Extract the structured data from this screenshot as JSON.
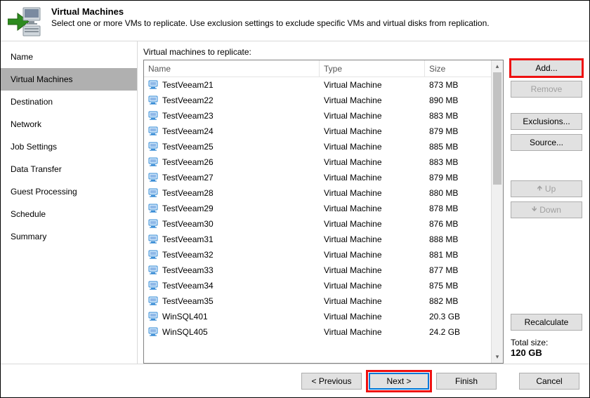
{
  "header": {
    "title": "Virtual Machines",
    "subtitle": "Select one or more VMs to replicate. Use exclusion settings to exclude specific VMs and virtual disks from replication."
  },
  "nav": {
    "items": [
      {
        "label": "Name",
        "selected": false
      },
      {
        "label": "Virtual Machines",
        "selected": true
      },
      {
        "label": "Destination",
        "selected": false
      },
      {
        "label": "Network",
        "selected": false
      },
      {
        "label": "Job Settings",
        "selected": false
      },
      {
        "label": "Data Transfer",
        "selected": false
      },
      {
        "label": "Guest Processing",
        "selected": false
      },
      {
        "label": "Schedule",
        "selected": false
      },
      {
        "label": "Summary",
        "selected": false
      }
    ]
  },
  "grid": {
    "label": "Virtual machines to replicate:",
    "columns": {
      "name": "Name",
      "type": "Type",
      "size": "Size"
    },
    "rows": [
      {
        "name": "TestVeeam21",
        "type": "Virtual Machine",
        "size": "873 MB"
      },
      {
        "name": "TestVeeam22",
        "type": "Virtual Machine",
        "size": "890 MB"
      },
      {
        "name": "TestVeeam23",
        "type": "Virtual Machine",
        "size": "883 MB"
      },
      {
        "name": "TestVeeam24",
        "type": "Virtual Machine",
        "size": "879 MB"
      },
      {
        "name": "TestVeeam25",
        "type": "Virtual Machine",
        "size": "885 MB"
      },
      {
        "name": "TestVeeam26",
        "type": "Virtual Machine",
        "size": "883 MB"
      },
      {
        "name": "TestVeeam27",
        "type": "Virtual Machine",
        "size": "879 MB"
      },
      {
        "name": "TestVeeam28",
        "type": "Virtual Machine",
        "size": "880 MB"
      },
      {
        "name": "TestVeeam29",
        "type": "Virtual Machine",
        "size": "878 MB"
      },
      {
        "name": "TestVeeam30",
        "type": "Virtual Machine",
        "size": "876 MB"
      },
      {
        "name": "TestVeeam31",
        "type": "Virtual Machine",
        "size": "888 MB"
      },
      {
        "name": "TestVeeam32",
        "type": "Virtual Machine",
        "size": "881 MB"
      },
      {
        "name": "TestVeeam33",
        "type": "Virtual Machine",
        "size": "877 MB"
      },
      {
        "name": "TestVeeam34",
        "type": "Virtual Machine",
        "size": "875 MB"
      },
      {
        "name": "TestVeeam35",
        "type": "Virtual Machine",
        "size": "882 MB"
      },
      {
        "name": "WinSQL401",
        "type": "Virtual Machine",
        "size": "20.3 GB"
      },
      {
        "name": "WinSQL405",
        "type": "Virtual Machine",
        "size": "24.2 GB"
      }
    ]
  },
  "right": {
    "add": "Add...",
    "remove": "Remove",
    "exclusions": "Exclusions...",
    "source": "Source...",
    "up": "Up",
    "down": "Down",
    "recalc": "Recalculate",
    "total_label": "Total size:",
    "total_value": "120 GB"
  },
  "footer": {
    "previous": "< Previous",
    "next": "Next >",
    "finish": "Finish",
    "cancel": "Cancel"
  }
}
